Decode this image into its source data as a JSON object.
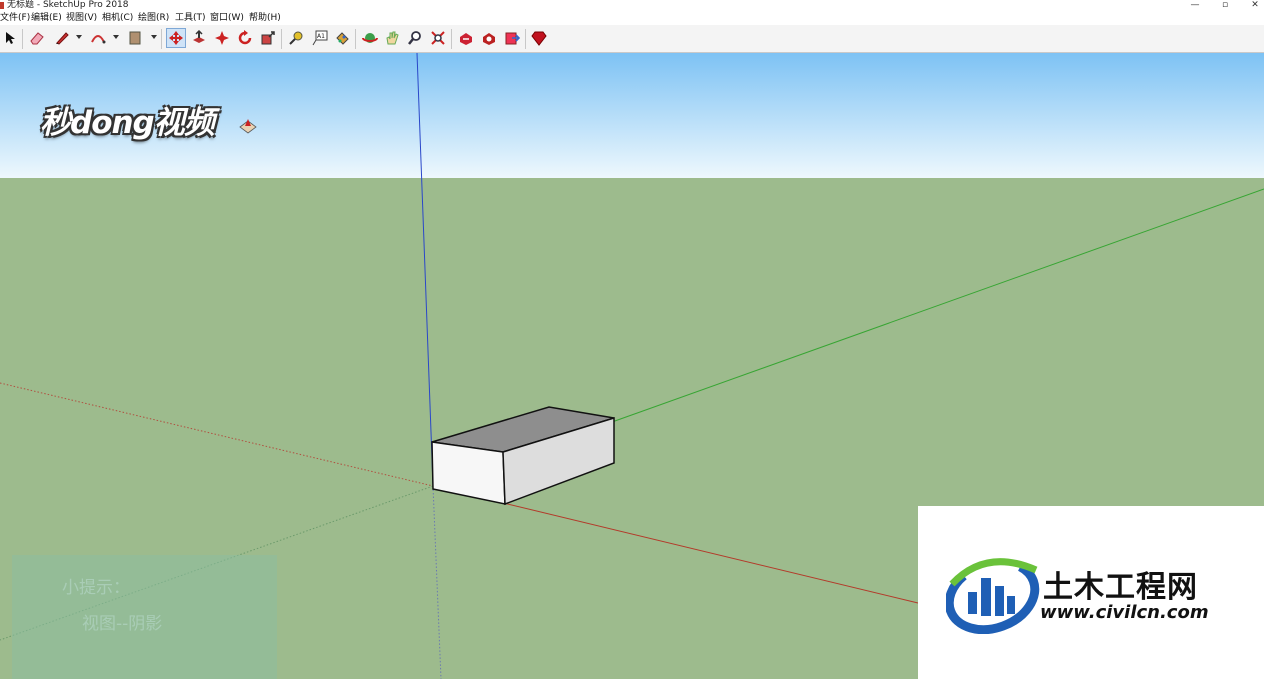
{
  "window": {
    "title": "无标题 - SketchUp Pro 2018",
    "controls": {
      "minimize": "—",
      "restore": "▫",
      "close": "✕"
    }
  },
  "menu": {
    "items": [
      "文件(F)",
      "编辑(E)",
      "视图(V)",
      "相机(C)",
      "绘图(R)",
      "工具(T)",
      "窗口(W)",
      "帮助(H)"
    ]
  },
  "toolbar": {
    "active_tool": "move-tool",
    "tools": [
      "select",
      "eraser",
      "line",
      "arc",
      "rectangle",
      "push-pull",
      "follow-me",
      "move",
      "rotate",
      "scale",
      "tape-measure",
      "text",
      "paint-bucket",
      "orbit",
      "pan",
      "zoom",
      "zoom-extents",
      "warehouse",
      "extension-warehouse",
      "send-to-layout",
      "ruby"
    ]
  },
  "viewport": {
    "sky_color": "#8cc9f2",
    "ground_color": "#9dbb8d",
    "axis_colors": {
      "red": "#c0392b",
      "green": "#3aa832",
      "blue": "#2a4fd0"
    }
  },
  "overlays": {
    "watermark_mdv": "秒dong视频",
    "tip_title": "小提示：",
    "tip_text": "视图--阴影",
    "civil_cn": "土木工程网",
    "civil_url": "www.civilcn.com"
  }
}
